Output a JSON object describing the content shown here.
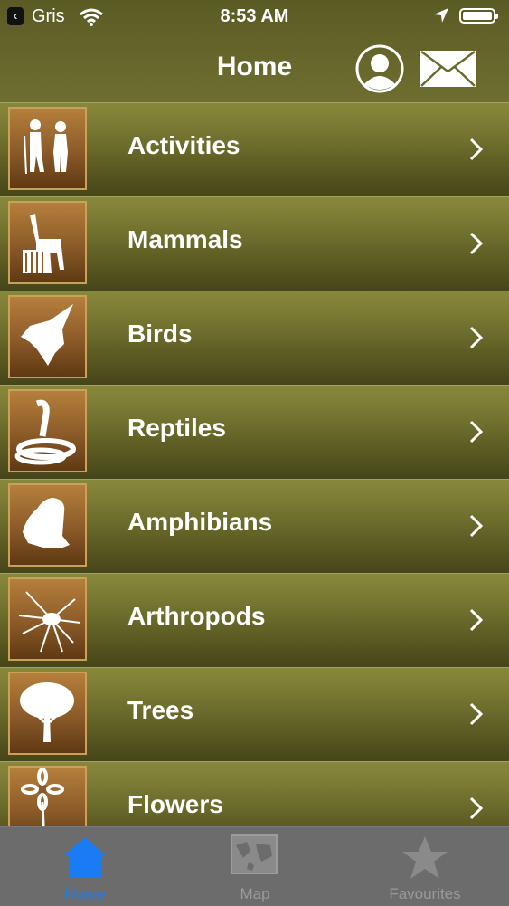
{
  "status_bar": {
    "carrier": "Gris",
    "time": "8:53 AM"
  },
  "nav": {
    "title": "Home",
    "profile_icon": "person-icon",
    "mail_icon": "envelope-icon"
  },
  "menu": [
    {
      "label": "Activities",
      "icon": "hikers-icon"
    },
    {
      "label": "Mammals",
      "icon": "giraffe-zebra-icon"
    },
    {
      "label": "Birds",
      "icon": "bird-icon"
    },
    {
      "label": "Reptiles",
      "icon": "snake-icon"
    },
    {
      "label": "Amphibians",
      "icon": "frog-icon"
    },
    {
      "label": "Arthropods",
      "icon": "spider-icon"
    },
    {
      "label": "Trees",
      "icon": "tree-icon"
    },
    {
      "label": "Flowers",
      "icon": "daisy-icon"
    }
  ],
  "tabs": [
    {
      "label": "Home",
      "icon": "house-icon",
      "active": true
    },
    {
      "label": "Map",
      "icon": "map-icon",
      "active": false
    },
    {
      "label": "Favourites",
      "icon": "star-icon",
      "active": false
    }
  ],
  "colors": {
    "active_tab": "#1a7cf5",
    "row_green": "#7a7a34",
    "thumb_border": "#caa15b"
  }
}
